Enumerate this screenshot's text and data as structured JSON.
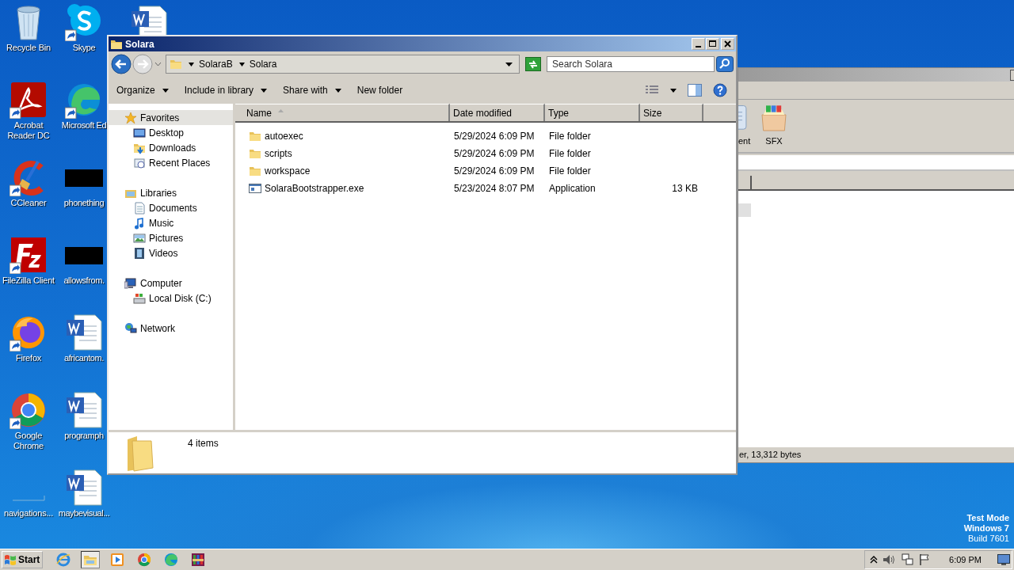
{
  "desktop_icons": [
    {
      "label": "Recycle Bin",
      "kind": "recycle",
      "shortcut": false
    },
    {
      "label": "Acrobat Reader DC",
      "kind": "acrobat",
      "shortcut": true
    },
    {
      "label": "CCleaner",
      "kind": "ccleaner",
      "shortcut": true
    },
    {
      "label": "FileZilla Client",
      "kind": "filezilla",
      "shortcut": true
    },
    {
      "label": "Firefox",
      "kind": "firefox",
      "shortcut": true
    },
    {
      "label": "Google Chrome",
      "kind": "chrome",
      "shortcut": true
    },
    {
      "label": "navigations...",
      "kind": "blank",
      "shortcut": false
    },
    {
      "label": "Skype",
      "kind": "skype",
      "shortcut": true
    },
    {
      "label": "Microsoft Ed",
      "kind": "edge",
      "shortcut": true
    },
    {
      "label": "phonething",
      "kind": "dark",
      "shortcut": false
    },
    {
      "label": "allowsfrom.",
      "kind": "dark",
      "shortcut": false
    },
    {
      "label": "africantom.",
      "kind": "word",
      "shortcut": false
    },
    {
      "label": "programph",
      "kind": "word",
      "shortcut": false
    },
    {
      "label": "maybevisual...",
      "kind": "word",
      "shortcut": false
    }
  ],
  "background_window": {
    "toolbar": [
      {
        "label": "ent",
        "kind": "doc"
      },
      {
        "label": "SFX",
        "kind": "box"
      }
    ],
    "status": "er, 13,312 bytes"
  },
  "explorer": {
    "title": "Solara",
    "breadcrumb": [
      "SolaraB",
      "Solara"
    ],
    "search": {
      "placeholder": "Search Solara"
    },
    "toolbar": [
      {
        "label": "Organize",
        "dropdown": true
      },
      {
        "label": "Include in library",
        "dropdown": true
      },
      {
        "label": "Share with",
        "dropdown": true
      },
      {
        "label": "New folder",
        "dropdown": false
      }
    ],
    "nav": [
      {
        "label": "Favorites",
        "kind": "star",
        "selected": true,
        "children": [
          {
            "label": "Desktop",
            "kind": "desktop",
            "selected": false
          },
          {
            "label": "Downloads",
            "kind": "downloads",
            "selected": false
          },
          {
            "label": "Recent Places",
            "kind": "recent",
            "selected": false
          }
        ]
      },
      {
        "label": "Libraries",
        "kind": "libraries",
        "selected": false,
        "children": [
          {
            "label": "Documents",
            "kind": "documents",
            "selected": false
          },
          {
            "label": "Music",
            "kind": "music",
            "selected": false
          },
          {
            "label": "Pictures",
            "kind": "pictures",
            "selected": false
          },
          {
            "label": "Videos",
            "kind": "videos",
            "selected": false
          }
        ]
      },
      {
        "label": "Computer",
        "kind": "computer",
        "selected": false,
        "children": [
          {
            "label": "Local Disk (C:)",
            "kind": "disk",
            "selected": false
          }
        ]
      },
      {
        "label": "Network",
        "kind": "network",
        "selected": false
      }
    ],
    "columns": [
      {
        "label": "Name",
        "sorted": true
      },
      {
        "label": "Date modified",
        "sorted": false
      },
      {
        "label": "Type",
        "sorted": false
      },
      {
        "label": "Size",
        "sorted": false
      }
    ],
    "rows": [
      {
        "name": "autoexec",
        "kind": "folder",
        "date": "5/29/2024 6:09 PM",
        "type": "File folder",
        "selected": false
      },
      {
        "name": "scripts",
        "kind": "folder",
        "date": "5/29/2024 6:09 PM",
        "type": "File folder",
        "selected": false
      },
      {
        "name": "workspace",
        "kind": "folder",
        "date": "5/29/2024 6:09 PM",
        "type": "File folder",
        "selected": false
      },
      {
        "name": "SolaraBootstrapper.exe",
        "kind": "app",
        "date": "5/23/2024 8:07 PM",
        "type": "Application",
        "size": "13 KB",
        "selected": false
      }
    ],
    "details": "4 items"
  },
  "desktop_notice": [
    "Test Mode",
    "Windows 7",
    "Build 7601"
  ],
  "taskbar": {
    "start": "Start",
    "apps": [
      {
        "kind": "ie",
        "active": false
      },
      {
        "kind": "explorer",
        "active": true
      },
      {
        "kind": "media",
        "active": false
      },
      {
        "kind": "chrome",
        "active": false
      },
      {
        "kind": "edge",
        "active": false
      },
      {
        "kind": "winrar",
        "active": false
      }
    ],
    "clock": "6:09 PM"
  }
}
